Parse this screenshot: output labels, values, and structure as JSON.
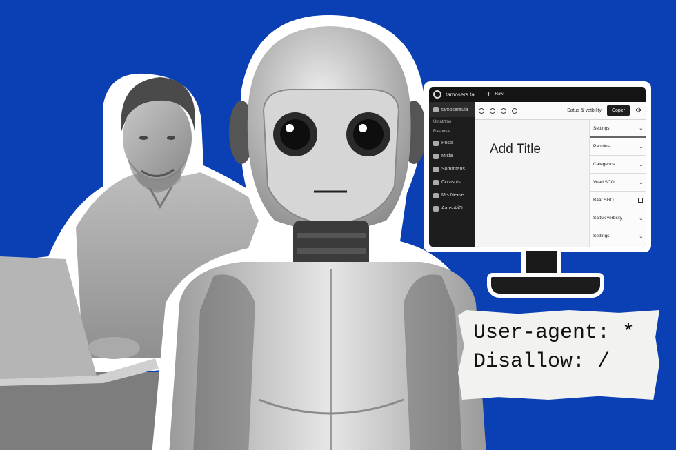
{
  "monitor": {
    "site_name": "tamosers ta",
    "new_label": "+",
    "new_text": "Haw",
    "sidebar": {
      "header": "tamoseraula",
      "section": "Umatrtme",
      "sub_item": "Rasoosa",
      "items": [
        "Posts",
        "Misia",
        "Sommrans",
        "Comsnts",
        "Mis Nexse",
        "Aans AliO"
      ]
    },
    "toolbar": {
      "status": "Satus & vetbility",
      "button": "Coper"
    },
    "editor_title": "Add Title",
    "panel": [
      "Settings",
      "Parmins",
      "Categencs",
      "Voad SCO",
      "Baat SGO",
      "Saltuk verbility",
      "Settings"
    ]
  },
  "note": {
    "line1": "User-agent: *",
    "line2": "Disallow: /"
  },
  "colors": {
    "background": "#0b3fb4",
    "paper": "#f2f2f0",
    "monitor_screen": "#1b1b1b"
  }
}
